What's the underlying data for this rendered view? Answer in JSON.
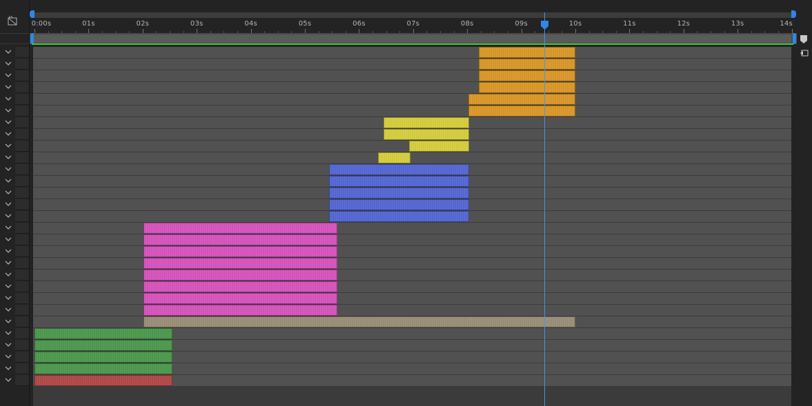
{
  "timeline": {
    "ruler_labels": [
      "0:00s",
      "01s",
      "02s",
      "03s",
      "04s",
      "05s",
      "06s",
      "07s",
      "08s",
      "09s",
      "10s",
      "11s",
      "12s",
      "13s",
      "14s"
    ],
    "current_time_seconds": 9.42,
    "duration_seconds": 14,
    "icons": {
      "comp_icon": "composition-mini-flowchart-icon",
      "marker_icon": "comp-marker-icon",
      "comp_button_icon": "comp-button-icon",
      "twirl_icon": "chevron-down-icon"
    },
    "colors": {
      "orange": "#de9a29",
      "yellow": "#d9d13e",
      "blue": "#5669d6",
      "pink": "#da55c0",
      "tan": "#9c917a",
      "green": "#4e9b4f",
      "red": "#b34a4a",
      "work_area_line": "#3ccd3c",
      "playhead": "#4a90e2"
    },
    "layers": [
      {
        "color": "orange",
        "in": 8.22,
        "out": 10.0
      },
      {
        "color": "orange",
        "in": 8.22,
        "out": 10.0
      },
      {
        "color": "orange",
        "in": 8.22,
        "out": 10.0
      },
      {
        "color": "orange",
        "in": 8.22,
        "out": 10.0
      },
      {
        "color": "orange",
        "in": 8.02,
        "out": 10.0
      },
      {
        "color": "orange",
        "in": 8.02,
        "out": 10.0
      },
      {
        "color": "yellow",
        "in": 6.45,
        "out": 8.04
      },
      {
        "color": "yellow",
        "in": 6.45,
        "out": 8.04
      },
      {
        "color": "yellow",
        "in": 6.92,
        "out": 8.04
      },
      {
        "color": "yellow",
        "in": 6.35,
        "out": 6.95
      },
      {
        "color": "blue",
        "in": 5.45,
        "out": 8.03
      },
      {
        "color": "blue",
        "in": 5.45,
        "out": 8.03
      },
      {
        "color": "blue",
        "in": 5.45,
        "out": 8.03
      },
      {
        "color": "blue",
        "in": 5.45,
        "out": 8.03
      },
      {
        "color": "blue",
        "in": 5.45,
        "out": 8.03
      },
      {
        "color": "pink",
        "in": 2.02,
        "out": 5.6
      },
      {
        "color": "pink",
        "in": 2.02,
        "out": 5.6
      },
      {
        "color": "pink",
        "in": 2.02,
        "out": 5.6
      },
      {
        "color": "pink",
        "in": 2.02,
        "out": 5.6
      },
      {
        "color": "pink",
        "in": 2.02,
        "out": 5.6
      },
      {
        "color": "pink",
        "in": 2.02,
        "out": 5.6
      },
      {
        "color": "pink",
        "in": 2.02,
        "out": 5.6
      },
      {
        "color": "pink",
        "in": 2.02,
        "out": 5.6
      },
      {
        "color": "tan",
        "in": 2.02,
        "out": 10.0
      },
      {
        "color": "green",
        "in": 0.0,
        "out": 2.55
      },
      {
        "color": "green",
        "in": 0.0,
        "out": 2.55
      },
      {
        "color": "green",
        "in": 0.0,
        "out": 2.55
      },
      {
        "color": "green",
        "in": 0.0,
        "out": 2.55
      },
      {
        "color": "red",
        "in": 0.0,
        "out": 2.55
      }
    ]
  }
}
